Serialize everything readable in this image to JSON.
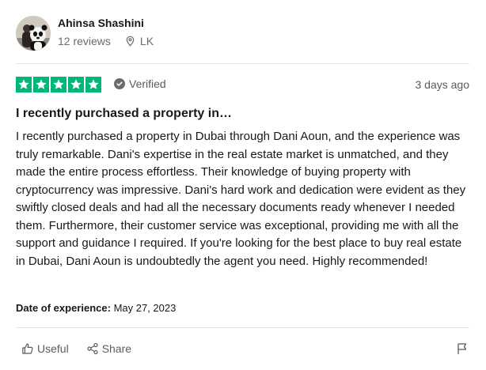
{
  "reviewer": {
    "name": "Ahinsa Shashini",
    "reviews_count": "12 reviews",
    "country": "LK"
  },
  "rating": {
    "stars": 5,
    "max_stars": 5,
    "star_color": "#00b67a",
    "verified_label": "Verified",
    "date_ago": "3 days ago"
  },
  "review": {
    "title": "I recently purchased a property in…",
    "body": "I recently purchased a property in Dubai through Dani Aoun, and the experience was truly remarkable. Dani's expertise in the real estate market is unmatched, and they made the entire process effortless. Their knowledge of buying property with cryptocurrency was impressive. Dani's hard work and dedication were evident as they swiftly closed deals and had all the necessary documents ready whenever I needed them. Furthermore, their customer service was exceptional, providing me with all the support and guidance I required. If you're looking for the best place to buy real estate in Dubai, Dani Aoun is undoubtedly the agent you need. Highly recommended!",
    "experience_label": "Date of experience:",
    "experience_date": "May 27, 2023"
  },
  "actions": {
    "useful_label": "Useful",
    "share_label": "Share",
    "useful_icon": "thumbs-up-icon",
    "share_icon": "share-icon",
    "report_icon": "flag-icon"
  }
}
